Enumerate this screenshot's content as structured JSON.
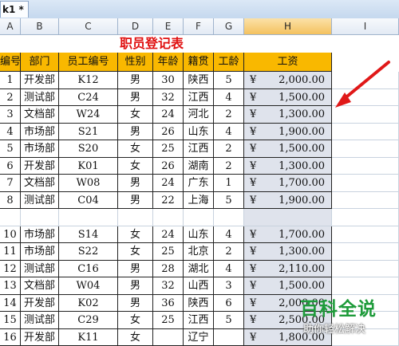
{
  "sheet_tab": {
    "label": "k1 *"
  },
  "columns": [
    "A",
    "B",
    "C",
    "D",
    "E",
    "F",
    "G",
    "H",
    "I"
  ],
  "title": "职员登记表",
  "headers": [
    "编号",
    "部门",
    "员工编号",
    "性别",
    "年龄",
    "籍贯",
    "工龄",
    "工资"
  ],
  "currency_symbol": "¥",
  "rows": [
    [
      "1",
      "开发部",
      "K12",
      "男",
      "30",
      "陕西",
      "5",
      "2,000.00"
    ],
    [
      "2",
      "测试部",
      "C24",
      "男",
      "32",
      "江西",
      "4",
      "1,500.00"
    ],
    [
      "3",
      "文档部",
      "W24",
      "女",
      "24",
      "河北",
      "2",
      "1,300.00"
    ],
    [
      "4",
      "市场部",
      "S21",
      "男",
      "26",
      "山东",
      "4",
      "1,900.00"
    ],
    [
      "5",
      "市场部",
      "S20",
      "女",
      "25",
      "江西",
      "2",
      "1,500.00"
    ],
    [
      "6",
      "开发部",
      "K01",
      "女",
      "26",
      "湖南",
      "2",
      "1,300.00"
    ],
    [
      "7",
      "文档部",
      "W08",
      "男",
      "24",
      "广东",
      "1",
      "1,700.00"
    ],
    [
      "8",
      "测试部",
      "C04",
      "男",
      "22",
      "上海",
      "5",
      "1,900.00"
    ],
    [
      "",
      "",
      "",
      "",
      "",
      "",
      "",
      ""
    ],
    [
      "10",
      "市场部",
      "S14",
      "女",
      "24",
      "山东",
      "4",
      "1,700.00"
    ],
    [
      "11",
      "市场部",
      "S22",
      "女",
      "25",
      "北京",
      "2",
      "1,300.00"
    ],
    [
      "12",
      "测试部",
      "C16",
      "男",
      "28",
      "湖北",
      "4",
      "2,110.00"
    ],
    [
      "13",
      "文档部",
      "W04",
      "男",
      "32",
      "山西",
      "3",
      "1,500.00"
    ],
    [
      "14",
      "开发部",
      "K02",
      "男",
      "36",
      "陕西",
      "6",
      "2,000.00"
    ],
    [
      "15",
      "测试部",
      "C29",
      "女",
      "25",
      "江西",
      "5",
      "2,500.00"
    ],
    [
      "16",
      "开发部",
      "K11",
      "女",
      "",
      "辽宁",
      "",
      "1,800.00"
    ]
  ],
  "watermark": {
    "main": "百科全说",
    "sub": "助你轻松解决"
  },
  "colors": {
    "title": "#e01010",
    "header_fill": "#f9b800",
    "salary_fill": "#dfe3ec",
    "arrow": "#e01818"
  }
}
